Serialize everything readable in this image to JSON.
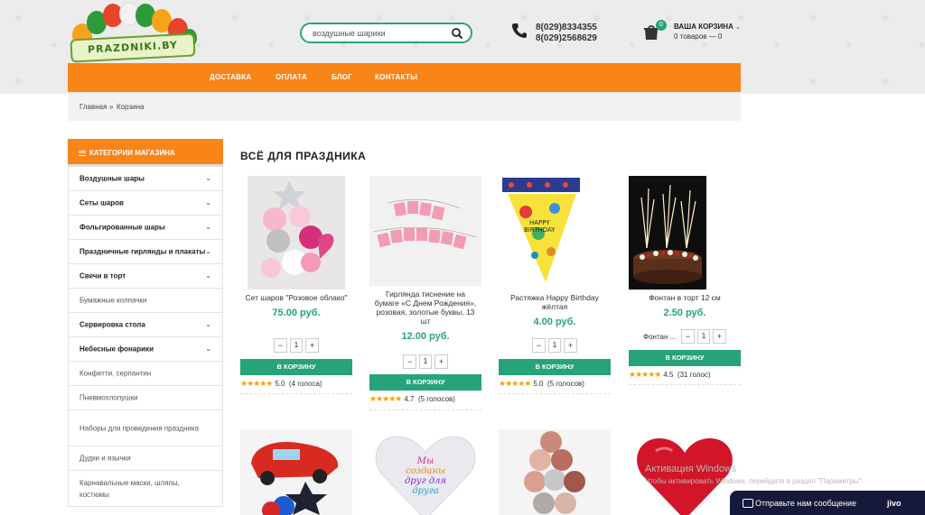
{
  "header": {
    "logo_text": "PRAZDNIKI.BY",
    "search": {
      "value": "воздушные шарики",
      "icon": "search-icon"
    },
    "phones": [
      "8(029)8334355",
      "8(029)2568629"
    ],
    "cart": {
      "title": "ВАША КОРЗИНА",
      "count_badge": "0",
      "summary": "0 товаров — 0"
    }
  },
  "nav": [
    "ДОСТАВКА",
    "ОПЛАТА",
    "БЛОГ",
    "КОНТАКТЫ"
  ],
  "breadcrumb": {
    "home": "Главная",
    "sep": "»",
    "current": "Корзина"
  },
  "sidebar": {
    "title": "КАТЕГОРИИ МАГАЗИНА",
    "items": [
      {
        "label": "Воздушные шары",
        "chevron": true
      },
      {
        "label": "Сеты шаров",
        "chevron": true
      },
      {
        "label": "Фольгированные шары",
        "chevron": true
      },
      {
        "label": "Праздничные гирлянды и плакаты",
        "chevron": true
      },
      {
        "label": "Свечи в торт",
        "chevron": true
      },
      {
        "label": "Бумажные колпачки",
        "chevron": false
      },
      {
        "label": "Сервировка стола",
        "chevron": true
      },
      {
        "label": "Небесные фонарики",
        "chevron": true
      },
      {
        "label": "Конфетти, серпантин",
        "chevron": false
      },
      {
        "label": "Пневмохлопушки",
        "chevron": false
      },
      {
        "label": "Наборы для проведения праздника",
        "chevron": false
      },
      {
        "label": "Дудки и язычки",
        "chevron": false
      },
      {
        "label": "Карнавальные маски, шляпы, костюмы",
        "chevron": false
      }
    ]
  },
  "section_title": "ВСЁ ДЛЯ ПРАЗДНИКА",
  "products": [
    {
      "name": "Сет шаров \"Розовое облако\"",
      "price": "75.00 руб.",
      "qty": "1",
      "cart_label": "В КОРЗИНУ",
      "rating_value": "5.0",
      "votes": "(4 голоса)",
      "stars": 5
    },
    {
      "name": "Гирлянда тиснение на бумаге «С Днем Рождения», розовая, золотые буквы, 13 шт",
      "price": "12.00 руб.",
      "qty": "1",
      "cart_label": "В КОРЗИНУ",
      "rating_value": "4.7",
      "votes": "(5 голосов)",
      "stars": 5
    },
    {
      "name": "Растяжка Happy Birthday жёлтая",
      "price": "4.00 руб.",
      "qty": "1",
      "cart_label": "В КОРЗИНУ",
      "rating_value": "5.0",
      "votes": "(5 голосов)",
      "stars": 5
    },
    {
      "name": "Фонтан в торт 12 см",
      "price": "2.50 руб.",
      "qty": "1",
      "variant": "Фонтан ...",
      "cart_label": "В КОРЗИНУ",
      "rating_value": "4.5",
      "votes": "(31 голос)",
      "stars": 5
    }
  ],
  "second_row": [
    {
      "image": "cars-balloon-bouquet"
    },
    {
      "image": "heart-balloon-text",
      "text": [
        "Мы",
        "созданы",
        "друг для",
        "друга"
      ]
    },
    {
      "image": "chrome-balloon-bouquet"
    },
    {
      "image": "red-heart-balloon"
    }
  ],
  "windows_watermark": {
    "title": "Активация Windows",
    "subtitle": "Чтобы активировать Windows, перейдите в раздел \"Параметры\"."
  },
  "chat": {
    "label": "Отправьте нам сообщение",
    "brand": "jivo"
  },
  "colors": {
    "accent_orange": "#f98418",
    "accent_green": "#27a37a",
    "star": "#f5a10a"
  }
}
